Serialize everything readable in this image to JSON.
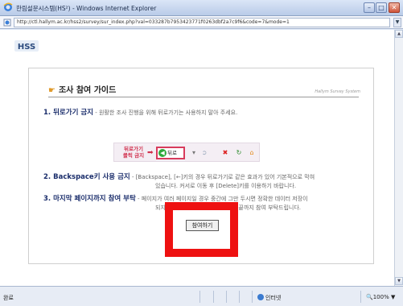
{
  "window": {
    "title": "한림설문시스템(HS²) - Windows Internet Explorer",
    "controls": {
      "minimize": "–",
      "maximize": "□",
      "close": "✕"
    }
  },
  "address": {
    "url": "http://ctl.hallym.ac.kr/hss2/survey/sur_index.php?val=033287b7953423771f0263dbf2a7c9f6&code=7&mode=1",
    "dropdown": "▼"
  },
  "page": {
    "logo_text": "HSS",
    "guide_title": "조사 참여 가이드",
    "brand_text": "Hallym Survey System",
    "steps": [
      {
        "title": "1. 뒤로가기 금지",
        "text": " - 원활한 조사 진행을 위해 뒤로가기는 사용하지 말아 주세요."
      },
      {
        "title": "2. Backspace키 사용 금지",
        "text": " - [Backspace], [←]키의 경우 뒤로가기로 같은 효과가 있어 기본적으로 막혀",
        "cont": "있습니다. 커서로 이동 후 [Delete]키를 이용하기 바랍니다."
      },
      {
        "title": "3. 마지막 페이지까지 참여 부탁",
        "text": " - 페이지가 여러 페이지일 경우 중간에 그만 두시면 정확한 데이터 저장이",
        "cont": "되지 않습니다. 정확한 조사를 위해 끝까지 참여 부탁드립니다."
      }
    ],
    "back_label": "뒤로가기\n클릭 금지",
    "back_button": "뒤로",
    "join_button": "참여하기"
  },
  "status": {
    "done": "완료",
    "zone": "인터넷",
    "zoom": "100%",
    "zoom_arrow": "▼"
  }
}
